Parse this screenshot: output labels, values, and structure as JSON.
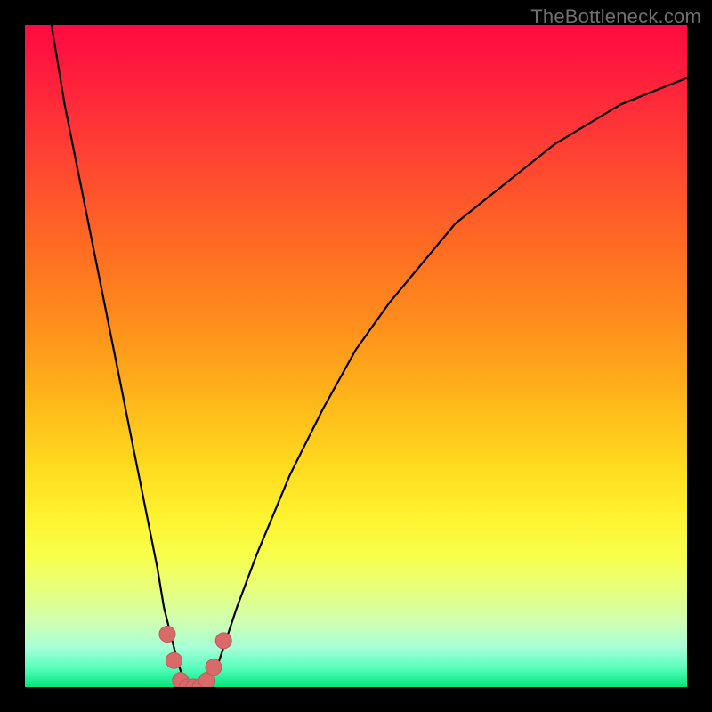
{
  "watermark": "TheBottleneck.com",
  "colors": {
    "frame": "#000000",
    "curve": "#000000",
    "marker_fill": "#d86a6a",
    "marker_stroke": "#c25858",
    "gradient_stops": [
      "#ff0a40",
      "#ff1340",
      "#ff3d35",
      "#ff6a23",
      "#ff8e1c",
      "#ffb41a",
      "#ffd81e",
      "#fff22f",
      "#f8ff4a",
      "#e8ff7a",
      "#d0ffb0",
      "#a8ffd8",
      "#5affbe",
      "#00e77a"
    ]
  },
  "chart_data": {
    "type": "line",
    "title": "",
    "xlabel": "",
    "ylabel": "",
    "xlim": [
      0,
      100
    ],
    "ylim": [
      0,
      100
    ],
    "grid": false,
    "legend": false,
    "series": [
      {
        "name": "bottleneck-curve",
        "x": [
          4,
          5,
          6,
          8,
          10,
          12,
          14,
          16,
          18,
          20,
          21,
          22,
          23,
          24,
          25,
          26,
          27,
          28,
          29,
          30,
          32,
          35,
          40,
          45,
          50,
          55,
          60,
          65,
          70,
          75,
          80,
          85,
          90,
          95,
          100
        ],
        "y": [
          100,
          94,
          88,
          78,
          68,
          58,
          48,
          38,
          28,
          18,
          12,
          8,
          4,
          1,
          0,
          0,
          0,
          1,
          3,
          6,
          12,
          20,
          32,
          42,
          51,
          58,
          64,
          70,
          74,
          78,
          82,
          85,
          88,
          90,
          92
        ]
      }
    ],
    "markers": {
      "name": "bottleneck-sweet-spot",
      "x": [
        21.5,
        22.5,
        23.5,
        24.5,
        25.5,
        26.5,
        27.5,
        28.5,
        30.0
      ],
      "y": [
        8,
        4,
        1,
        0,
        0,
        0,
        1,
        3,
        7
      ]
    }
  }
}
